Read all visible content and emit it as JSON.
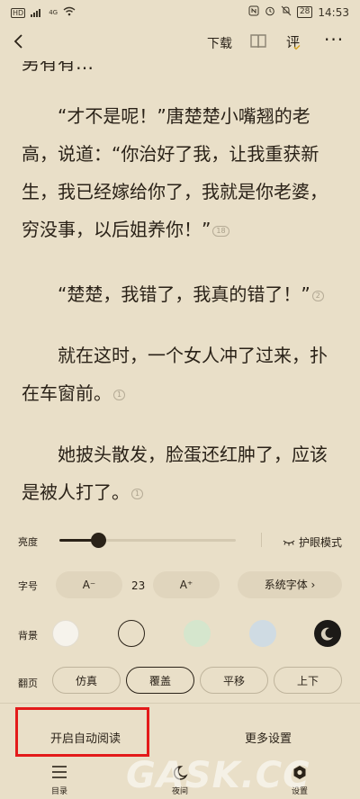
{
  "statusbar": {
    "left_text": "HD",
    "net_label": "4G",
    "battery": "28",
    "time": "14:53"
  },
  "toolbar": {
    "download_label": "下载",
    "review_label": "评"
  },
  "reader": {
    "cut_line": "男有有… ",
    "paragraphs": [
      {
        "text": "“才不是呢！”唐楚楚小嘴翘的老高，说道：“你治好了我，让我重获新生，我已经嫁给你了，我就是你老婆，穷没事，以后姐养你！”",
        "comments": "18"
      },
      {
        "text": "“楚楚，我错了，我真的错了！”",
        "comments": "2"
      },
      {
        "text": "就在这时，一个女人冲了过来，扑在车窗前。",
        "comments": "1"
      },
      {
        "text": "她披头散发，脸蛋还红肿了，应该是被人打了。",
        "comments": "1"
      }
    ]
  },
  "settings": {
    "brightness_label": "亮度",
    "brightness_level": 0.22,
    "eye_mode_label": "护眼模式",
    "font_size_label": "字号",
    "font_decrease": "A⁻",
    "font_size_value": "23",
    "font_increase": "A⁺",
    "system_font": "系统字体 ›",
    "background_label": "背景",
    "background_colors": [
      "#f6f3ec",
      "#e9dfc8",
      "#d5e6cd",
      "#cfdbe3",
      "#1c1a17"
    ],
    "page_turn_label": "翻页",
    "page_turn_options": [
      "仿真",
      "覆盖",
      "平移",
      "上下"
    ],
    "page_turn_selected": "覆盖",
    "auto_read": "开启自动阅读",
    "more_settings": "更多设置"
  },
  "tabbar": {
    "items": [
      {
        "label": "目录",
        "icon": "menu-icon"
      },
      {
        "label": "夜间",
        "icon": "moon-icon"
      },
      {
        "label": "设置",
        "icon": "gear-icon"
      }
    ]
  },
  "watermark": "GASK.CC"
}
